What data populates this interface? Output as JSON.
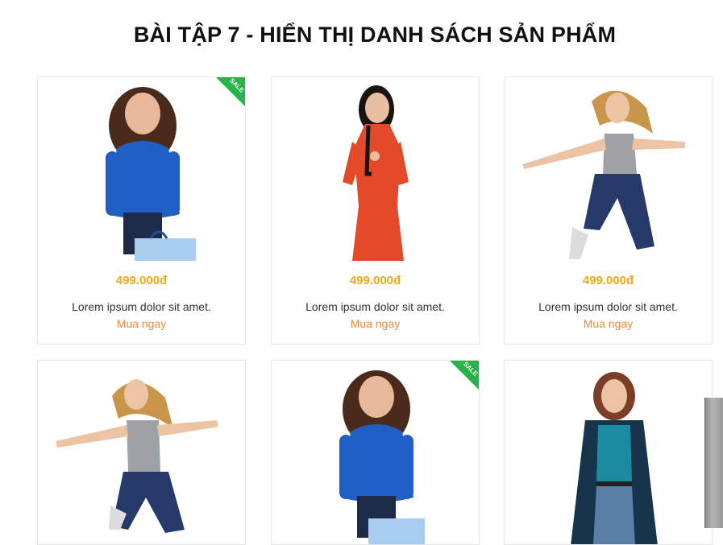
{
  "page": {
    "title": "BÀI TẬP 7 - HIỂN THỊ DANH SÁCH SẢN PHẨM"
  },
  "colors": {
    "price": "#f0a81a",
    "buy_link": "#f08a3a",
    "sale_badge": "#27b24a"
  },
  "products": [
    {
      "price": "499.000đ",
      "description": "Lorem ipsum dolor sit amet.",
      "buy_label": "Mua ngay",
      "sale_badge": "SALE",
      "image_icon": "woman-blue-sweater-shopping-bag"
    },
    {
      "price": "499.000đ",
      "description": "Lorem ipsum dolor sit amet.",
      "buy_label": "Mua ngay",
      "image_icon": "woman-red-dress"
    },
    {
      "price": "499.000đ",
      "description": "Lorem ipsum dolor sit amet.",
      "buy_label": "Mua ngay",
      "image_icon": "woman-jumping"
    },
    {
      "image_icon": "woman-jumping"
    },
    {
      "sale_badge": "SALE",
      "image_icon": "woman-blue-sweater-shopping-bag"
    },
    {
      "image_icon": "woman-dark-cardigan"
    }
  ]
}
